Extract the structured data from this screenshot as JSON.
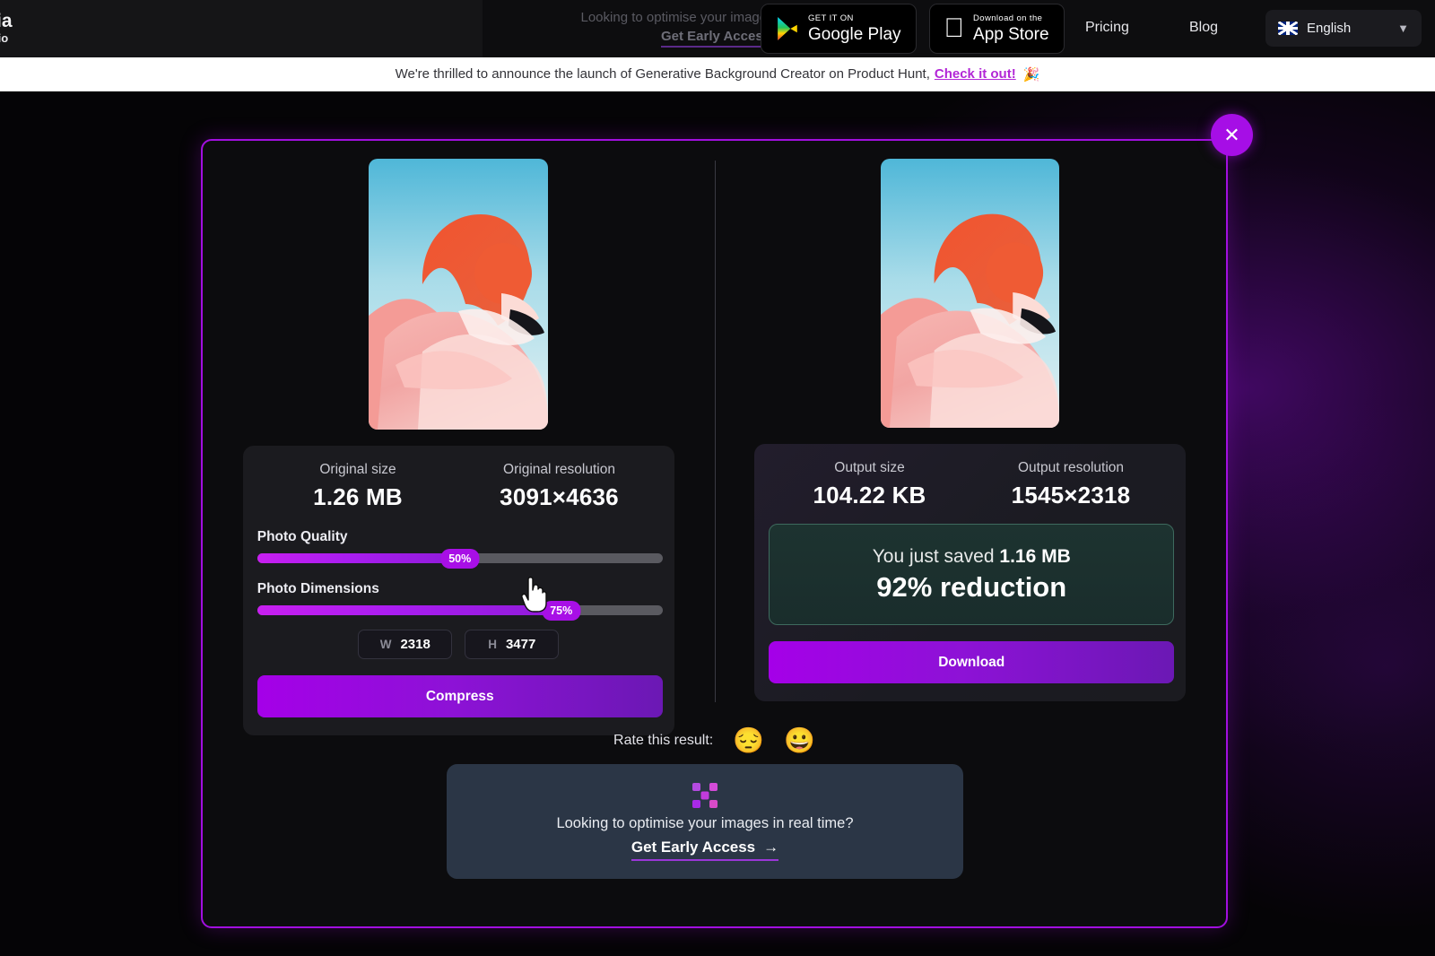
{
  "header": {
    "logo_fragment_line1": "ia",
    "logo_fragment_line2": ".io",
    "ghost_promo_line1": "Looking to optimise your images in real time?",
    "ghost_promo_line2": "Get Early Access",
    "google_play": {
      "small": "GET IT ON",
      "big": "Google Play",
      "icon": "google-play-icon"
    },
    "app_store": {
      "small": "Download on the",
      "big": "App Store",
      "icon": "apple-icon"
    },
    "nav": [
      {
        "label": "Pricing"
      },
      {
        "label": "Blog"
      }
    ],
    "language": {
      "label": "English",
      "flag": "uk-flag-icon",
      "chevron": "chevron-down-icon"
    }
  },
  "banner": {
    "text": "We're thrilled to announce the launch of Generative Background Creator on Product Hunt,",
    "link": "Check it out!",
    "emoji": "🎉"
  },
  "modal": {
    "close_icon": "close-icon",
    "border_color": "#a20fe0",
    "original": {
      "size_label": "Original size",
      "size_value": "1.26 MB",
      "resolution_label": "Original resolution",
      "resolution_value": "3091×4636",
      "quality_label": "Photo Quality",
      "quality_badge": "50%",
      "quality_percent": 50,
      "dimensions_label": "Photo Dimensions",
      "dimensions_badge": "75%",
      "dimensions_percent": 75,
      "width_key": "W",
      "width_value": "2318",
      "height_key": "H",
      "height_value": "3477",
      "compress_label": "Compress"
    },
    "output": {
      "size_label": "Output size",
      "size_value": "104.22 KB",
      "resolution_label": "Output resolution",
      "resolution_value": "1545×2318",
      "saved_prefix": "You just saved ",
      "saved_amount": "1.16 MB",
      "reduction": "92% reduction",
      "download_label": "Download"
    },
    "rating": {
      "label": "Rate this result:",
      "sad_emoji": "😔",
      "happy_emoji": "😀"
    },
    "cta": {
      "logo": "x-logo-icon",
      "text": "Looking to optimise your images in real time?",
      "link": "Get Early Access",
      "arrow": "→"
    }
  }
}
